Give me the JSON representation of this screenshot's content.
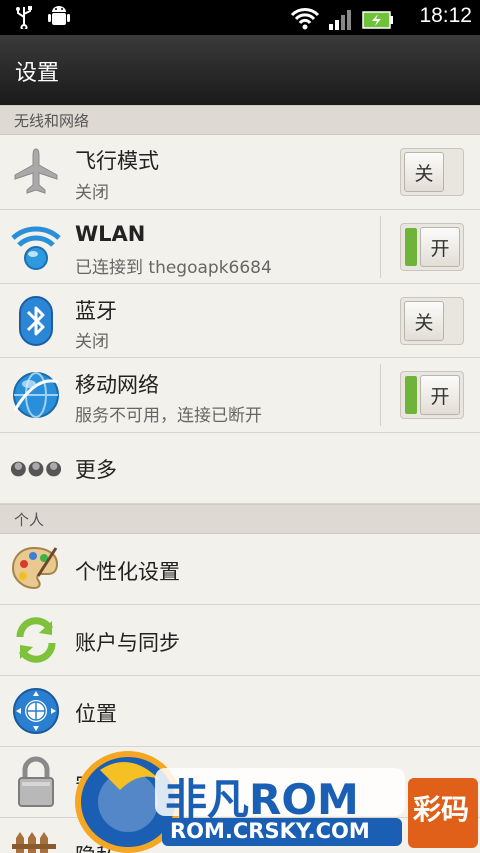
{
  "status_bar": {
    "time": "18:12",
    "icons": [
      "usb-icon",
      "android-debug-icon",
      "wifi-icon",
      "signal-icon",
      "battery-charging-icon"
    ]
  },
  "title_bar": {
    "title": "设置"
  },
  "sections": {
    "wireless": {
      "header": "无线和网络"
    },
    "personal": {
      "header": "个人"
    }
  },
  "rows": {
    "airplane": {
      "label": "飞行模式",
      "sub": "关闭",
      "toggle": "关",
      "state": "off"
    },
    "wlan": {
      "label": "WLAN",
      "sub": "已连接到 thegoapk6684",
      "toggle": "开",
      "state": "on"
    },
    "bluetooth": {
      "label": "蓝牙",
      "sub": "关闭",
      "toggle": "关",
      "state": "off"
    },
    "mobile": {
      "label": "移动网络",
      "sub": "服务不可用，连接已断开",
      "toggle": "开",
      "state": "on"
    },
    "more": {
      "label": "更多"
    },
    "personalize": {
      "label": "个性化设置"
    },
    "accounts": {
      "label": "账户与同步"
    },
    "location": {
      "label": "位置"
    },
    "security": {
      "label": "安全"
    },
    "privacy": {
      "label": "隐私"
    }
  },
  "watermark": {
    "brand": "非凡ROM",
    "url": "ROM.CRSKY.COM",
    "right_text": "彩码"
  },
  "colors": {
    "accent_green": "#6fb33a",
    "title_bar": "#222222"
  }
}
